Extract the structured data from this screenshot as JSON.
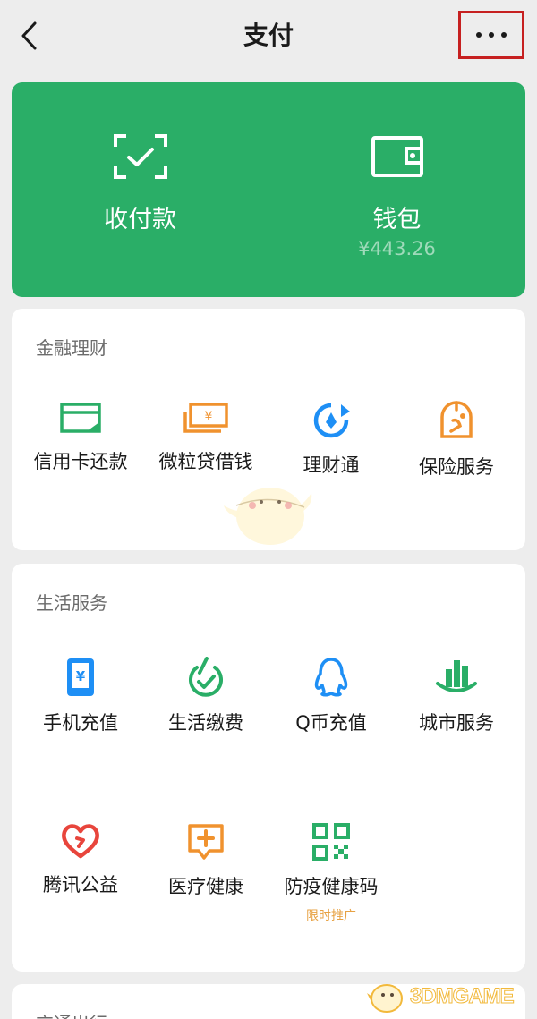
{
  "header": {
    "title": "支付"
  },
  "hero": {
    "collect": {
      "label": "收付款"
    },
    "wallet": {
      "label": "钱包",
      "balance": "¥443.26"
    }
  },
  "finance": {
    "title": "金融理财",
    "items": [
      {
        "label": "信用卡还款",
        "icon": "credit-card-icon"
      },
      {
        "label": "微粒贷借钱",
        "icon": "loan-bills-icon"
      },
      {
        "label": "理财通",
        "icon": "wealth-icon"
      },
      {
        "label": "保险服务",
        "icon": "insurance-icon"
      }
    ]
  },
  "life": {
    "title": "生活服务",
    "items": [
      {
        "label": "手机充值",
        "icon": "phone-topup-icon"
      },
      {
        "label": "生活缴费",
        "icon": "utility-payment-icon"
      },
      {
        "label": "Q币充值",
        "icon": "qq-penguin-icon"
      },
      {
        "label": "城市服务",
        "icon": "city-buildings-icon"
      },
      {
        "label": "腾讯公益",
        "icon": "charity-heart-icon"
      },
      {
        "label": "医疗健康",
        "icon": "medical-icon"
      },
      {
        "label": "防疫健康码",
        "icon": "qr-code-icon",
        "tag": "限时推广"
      }
    ]
  },
  "transport": {
    "title": "交通出行"
  },
  "watermark": {
    "text": "3DMGAME"
  },
  "colors": {
    "brand_green": "#2aae67",
    "orange": "#f0922e",
    "blue": "#1e8ff5",
    "red": "#e8453c",
    "highlight": "#c62020"
  }
}
